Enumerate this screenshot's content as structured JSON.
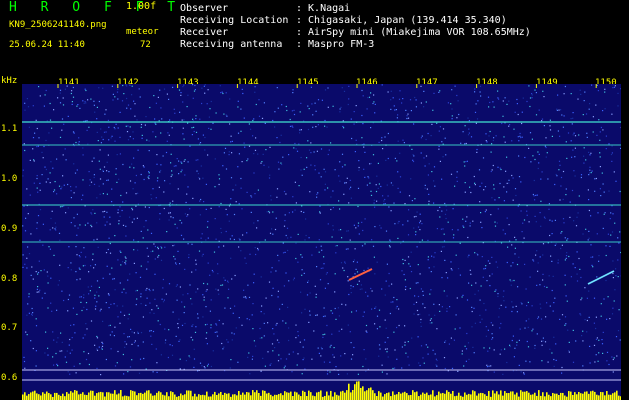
{
  "header": {
    "brand": "H R O F F T",
    "version": "1.00f",
    "filename": "KN9_2506241140.png",
    "datetime": "25.06.24 11:40",
    "meteor_label": "meteor",
    "meteor_count": "72",
    "fields": [
      {
        "label": "Observer",
        "value": ": K.Nagai"
      },
      {
        "label": "Receiving Location",
        "value": ": Chigasaki, Japan (139.414 35.340)"
      },
      {
        "label": "Receiver",
        "value": ": AirSpy mini (Miakejima VOR 108.65MHz)"
      },
      {
        "label": "Receiving antenna",
        "value": ": Maspro FM-3"
      }
    ]
  },
  "axis": {
    "y_unit": "kHz",
    "x_ticks": [
      "1141",
      "1142",
      "1143",
      "1144",
      "1145",
      "1146",
      "1147",
      "1148",
      "1149",
      "1150"
    ],
    "y_ticks": [
      "1.1",
      "1.0",
      "0.9",
      "0.8",
      "0.7",
      "0.6"
    ]
  },
  "colors": {
    "background": "#000000",
    "plot": "#0a0a6a",
    "text_yellow": "#ffff00",
    "text_green": "#00ff00"
  }
}
